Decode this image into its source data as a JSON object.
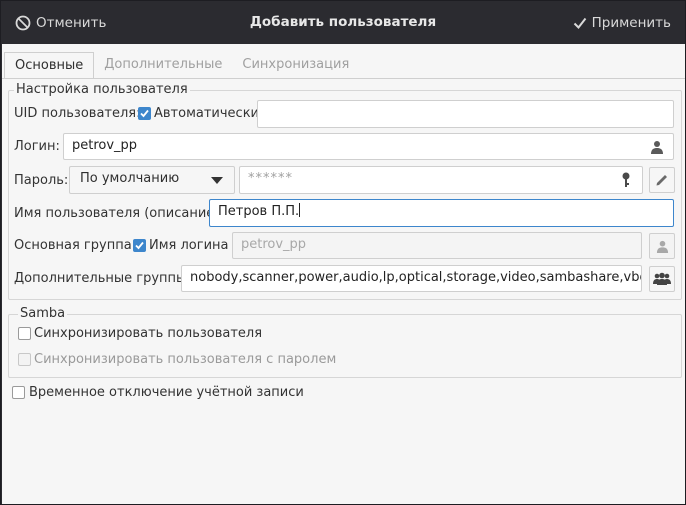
{
  "header": {
    "cancel_label": "Отменить",
    "title": "Добавить пользователя",
    "apply_label": "Применить"
  },
  "tabs": [
    {
      "label": "Основные",
      "active": true
    },
    {
      "label": "Дополнительные",
      "active": false
    },
    {
      "label": "Синхронизация",
      "active": false
    }
  ],
  "user_settings": {
    "group_title": "Настройка пользователя",
    "uid_label": "UID пользователя:",
    "uid_auto_label": "Автоматически",
    "uid_auto_checked": true,
    "uid_value": "",
    "login_label": "Логин:",
    "login_value": "petrov_pp",
    "password_label": "Пароль:",
    "password_mode": "По умолчанию",
    "password_value": "******",
    "description_label": "Имя пользователя (описание):",
    "description_value": "Петров П.П.",
    "primary_group_label": "Основная группа:",
    "primary_group_login_label": "Имя логина",
    "primary_group_login_checked": true,
    "primary_group_value": "petrov_pp",
    "extra_groups_label": "Дополнительные группы:",
    "extra_groups_value": "nobody,scanner,power,audio,lp,optical,storage,video,sambashare,vboxusers"
  },
  "samba": {
    "group_title": "Samba",
    "sync_user_label": "Синхронизировать пользователя",
    "sync_user_checked": false,
    "sync_password_label": "Синхронизировать пользователя с паролем",
    "sync_password_checked": false
  },
  "disable_account_label": "Временное отключение учётной записи",
  "disable_account_checked": false,
  "colors": {
    "header_bg": "#2b2b30",
    "content_bg": "#f6f6f6",
    "accent": "#3d86cc"
  }
}
